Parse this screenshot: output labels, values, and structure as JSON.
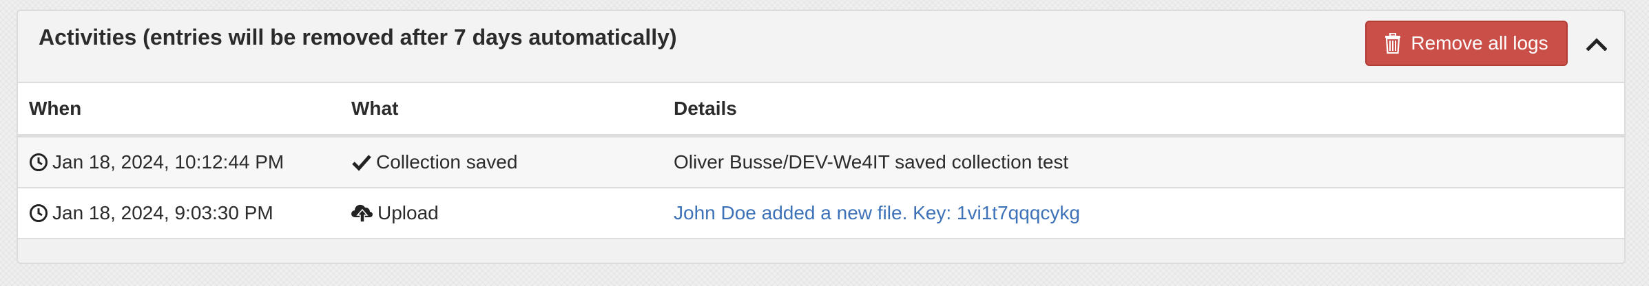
{
  "panel": {
    "title": "Activities (entries will be removed after 7 days automatically)",
    "remove_button_label": "Remove all logs",
    "collapse_icon": "chevron-up-icon",
    "remove_icon": "trash-icon",
    "accent_danger": "#cb4f49",
    "link_color": "#3d72b8"
  },
  "table": {
    "headers": [
      "When",
      "What",
      "Details"
    ],
    "rows": [
      {
        "when": "Jan 18, 2024, 10:12:44 PM",
        "when_icon": "clock-icon",
        "what": "Collection saved",
        "what_icon": "checkmark-icon",
        "details": "Oliver Busse/DEV-We4IT saved collection test"
      },
      {
        "when": "Jan 18, 2024, 9:03:30 PM",
        "when_icon": "clock-icon",
        "what": "Upload",
        "what_icon": "cloud-upload-icon",
        "details": "John Doe added a new file. Key: 1vi1t7qqqcykg"
      }
    ]
  }
}
